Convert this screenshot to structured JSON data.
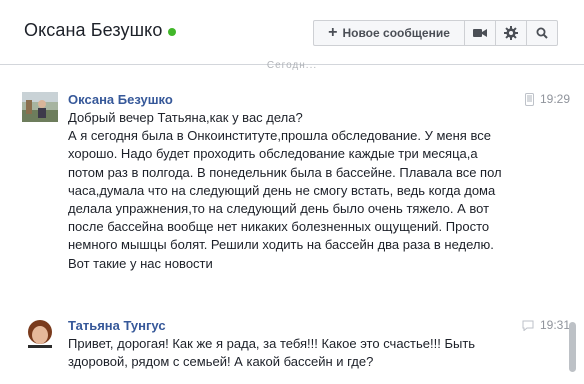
{
  "header": {
    "contact_name": "Оксана Безушко",
    "online_status_color": "#42b72a",
    "new_message_label": "Новое сообщение",
    "icons": [
      "video-call-icon",
      "gear-icon",
      "search-icon"
    ]
  },
  "divider": {
    "label": "Сегодн..."
  },
  "messages": [
    {
      "author": "Оксана Безушко",
      "time": "19:29",
      "source_icon": "mobile-phone-icon",
      "text": "Добрый вечер Татьяна,как у вас дела?\nА  я сегодня была в Онкоинституте,прошла обследование. У меня все хорошо. Надо будет проходить обследование каждые три месяца,а потом раз в полгода. В понедельник была в бассейне. Плавала все пол часа,думала что на следующий день не смогу встать, ведь когда дома делала упражнения,то на следующий день было очень тяжело. А вот после бассейна вообще нет никаких болезненных ощущений. Просто немного мышцы болят. Решили ходить на бассейн два раза в неделю. Вот такие у нас новости"
    },
    {
      "author": "Татьяна Тунгус",
      "time": "19:31",
      "source_icon": "chat-bubble-icon",
      "text": "Привет, дорогая! Как же я рада, за тебя!!! Какое это счастье!!! Быть здоровой, рядом с семьей! А какой бассейн и где?"
    }
  ]
}
